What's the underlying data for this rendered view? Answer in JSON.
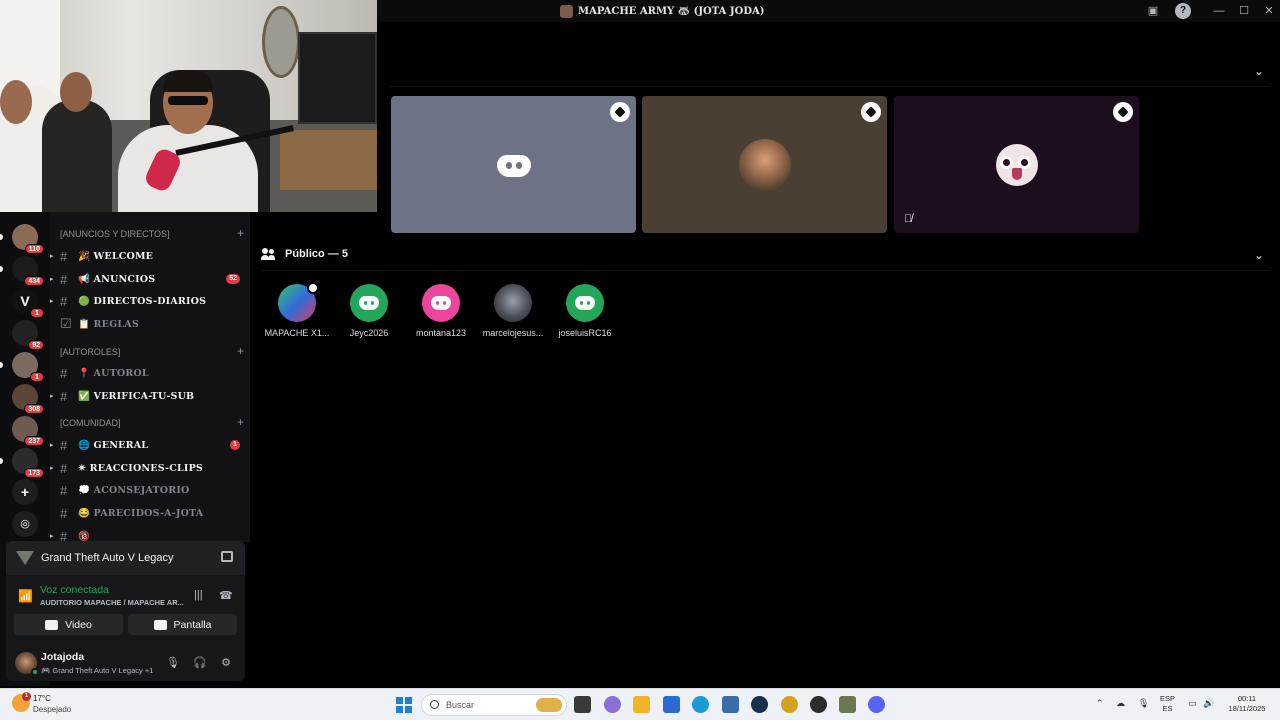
{
  "window": {
    "title": "MAPACHE ARMY 🦝 (JOTA JODA)"
  },
  "server_rail": {
    "badges": [
      "110",
      "434",
      "1",
      "92",
      "1",
      "308",
      "237",
      "173"
    ],
    "add_label": "+",
    "explore_label": "◎"
  },
  "channels": {
    "categories": [
      {
        "label": "[ANUNCIOS Y DIRECTOS]"
      },
      {
        "label": "[AUTOROLES]"
      },
      {
        "label": "[COMUNIDAD]"
      }
    ],
    "items": [
      {
        "name": "🎉 WELCOME",
        "unread": true
      },
      {
        "name": "📢 ANUNCIOS",
        "unread": true,
        "badge": "52"
      },
      {
        "name": "🟢 DIRECTOS-DIARIOS",
        "unread": true
      },
      {
        "name": "📋 REGLAS",
        "unread": false
      },
      {
        "name": "📍 AUTOROL",
        "unread": false
      },
      {
        "name": "✅ VERIFICA-TU-SUB",
        "unread": true
      },
      {
        "name": "🌐 GENERAL",
        "unread": true,
        "badge": "1"
      },
      {
        "name": "✴ REACCIONES-CLIPS",
        "unread": true
      },
      {
        "name": "💭 ACONSEJATORIO",
        "unread": false
      },
      {
        "name": "😂 PARECIDOS-A-JOTA",
        "unread": false
      },
      {
        "name": "🔞",
        "unread": true
      }
    ]
  },
  "panel": {
    "game_title": "Grand Theft Auto V Legacy",
    "voice_status": "Voz conectada",
    "voice_channel": "AUDITORIO MAPACHE / MAPACHE AR...",
    "video_label": "Video",
    "screen_label": "Pantalla",
    "username": "Jotajoda",
    "user_activity": "🎮 Grand Theft Auto V Legacy +1"
  },
  "stage": {
    "audience_header": "Público — 5",
    "audience": [
      {
        "name": "MAPACHE X1...",
        "color": "#2f6dd6"
      },
      {
        "name": "Jeyc2026",
        "color": "#23a55a"
      },
      {
        "name": "montana123",
        "color": "#eb459e"
      },
      {
        "name": "marcelojesus...",
        "color": "#4b5058"
      },
      {
        "name": "joseluisRC16",
        "color": "#23a55a"
      }
    ],
    "tiles": [
      {
        "bg": "#6d7385"
      },
      {
        "bg": "#4a3f33"
      },
      {
        "bg": "#1c0e1c"
      }
    ]
  },
  "taskbar": {
    "weather_temp": "17°C",
    "weather_desc": "Despejado",
    "weather_badge": "1",
    "search_placeholder": "Buscar",
    "lang_top": "ESP",
    "lang_bottom": "ES",
    "time": "00:11",
    "date": "18/11/2025"
  },
  "colors": {
    "accent_green": "#23a55a",
    "badge_red": "#e03e43",
    "discord_blurple": "#5865f2"
  }
}
